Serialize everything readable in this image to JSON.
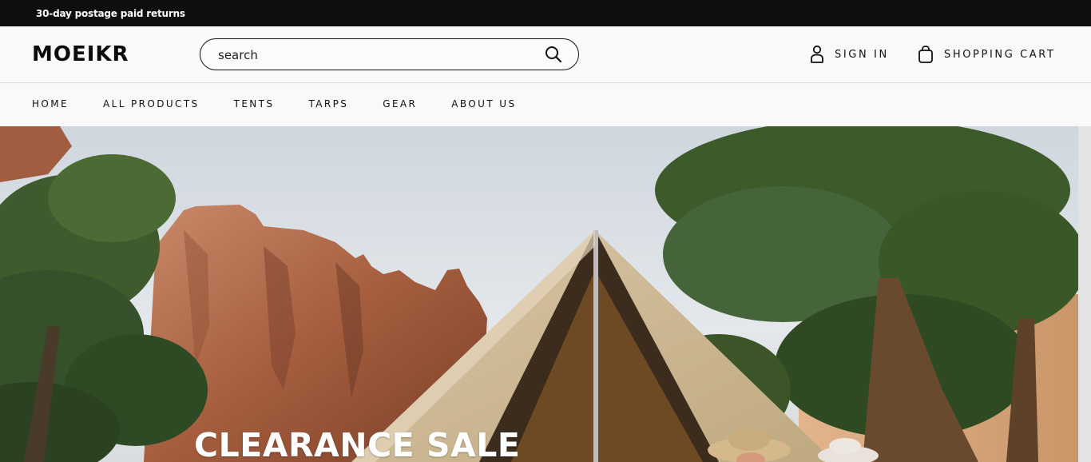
{
  "announcement": {
    "text": "30-day postage paid returns"
  },
  "header": {
    "logo": "MOEIKR",
    "search": {
      "placeholder": "search",
      "value": ""
    },
    "sign_in_label": "SIGN IN",
    "cart_label": "SHOPPING CART"
  },
  "nav": {
    "items": [
      "HOME",
      "ALL PRODUCTS",
      "TENTS",
      "TARPS",
      "GEAR",
      "ABOUT US"
    ]
  },
  "hero": {
    "title": "CLEARANCE SALE"
  },
  "icons": {
    "search": "search-icon",
    "user": "user-icon",
    "bag": "shopping-bag-icon"
  },
  "colors": {
    "announcement_bg": "#0e0e0e",
    "header_bg": "#f9f9f9",
    "text": "#111111"
  }
}
